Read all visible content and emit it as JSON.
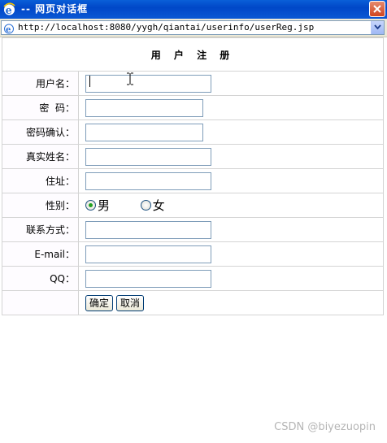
{
  "window": {
    "title": "-- 网页对话框",
    "address_url": "http://localhost:8080/yygh/qiantai/userinfo/userReg.jsp"
  },
  "form": {
    "header": "用 户 注 册",
    "fields": {
      "username_label": "用户名：",
      "password_label": "密  码：",
      "confirm_label": "密码确认：",
      "realname_label": "真实姓名：",
      "address_label": "住址：",
      "gender_label": "性别：",
      "contact_label": "联系方式：",
      "email_label": "E-mail：",
      "qq_label": "QQ："
    },
    "gender_options": {
      "male": "男",
      "female": "女",
      "selected": "男"
    },
    "buttons": {
      "confirm": "确定",
      "cancel": "取消"
    }
  },
  "watermark": "CSDN @biyezuopin",
  "colors": {
    "titlebar": "#0047c8",
    "input_border": "#7f9db9",
    "table_border": "#d4d4d4",
    "radio_dot": "#21a121"
  }
}
